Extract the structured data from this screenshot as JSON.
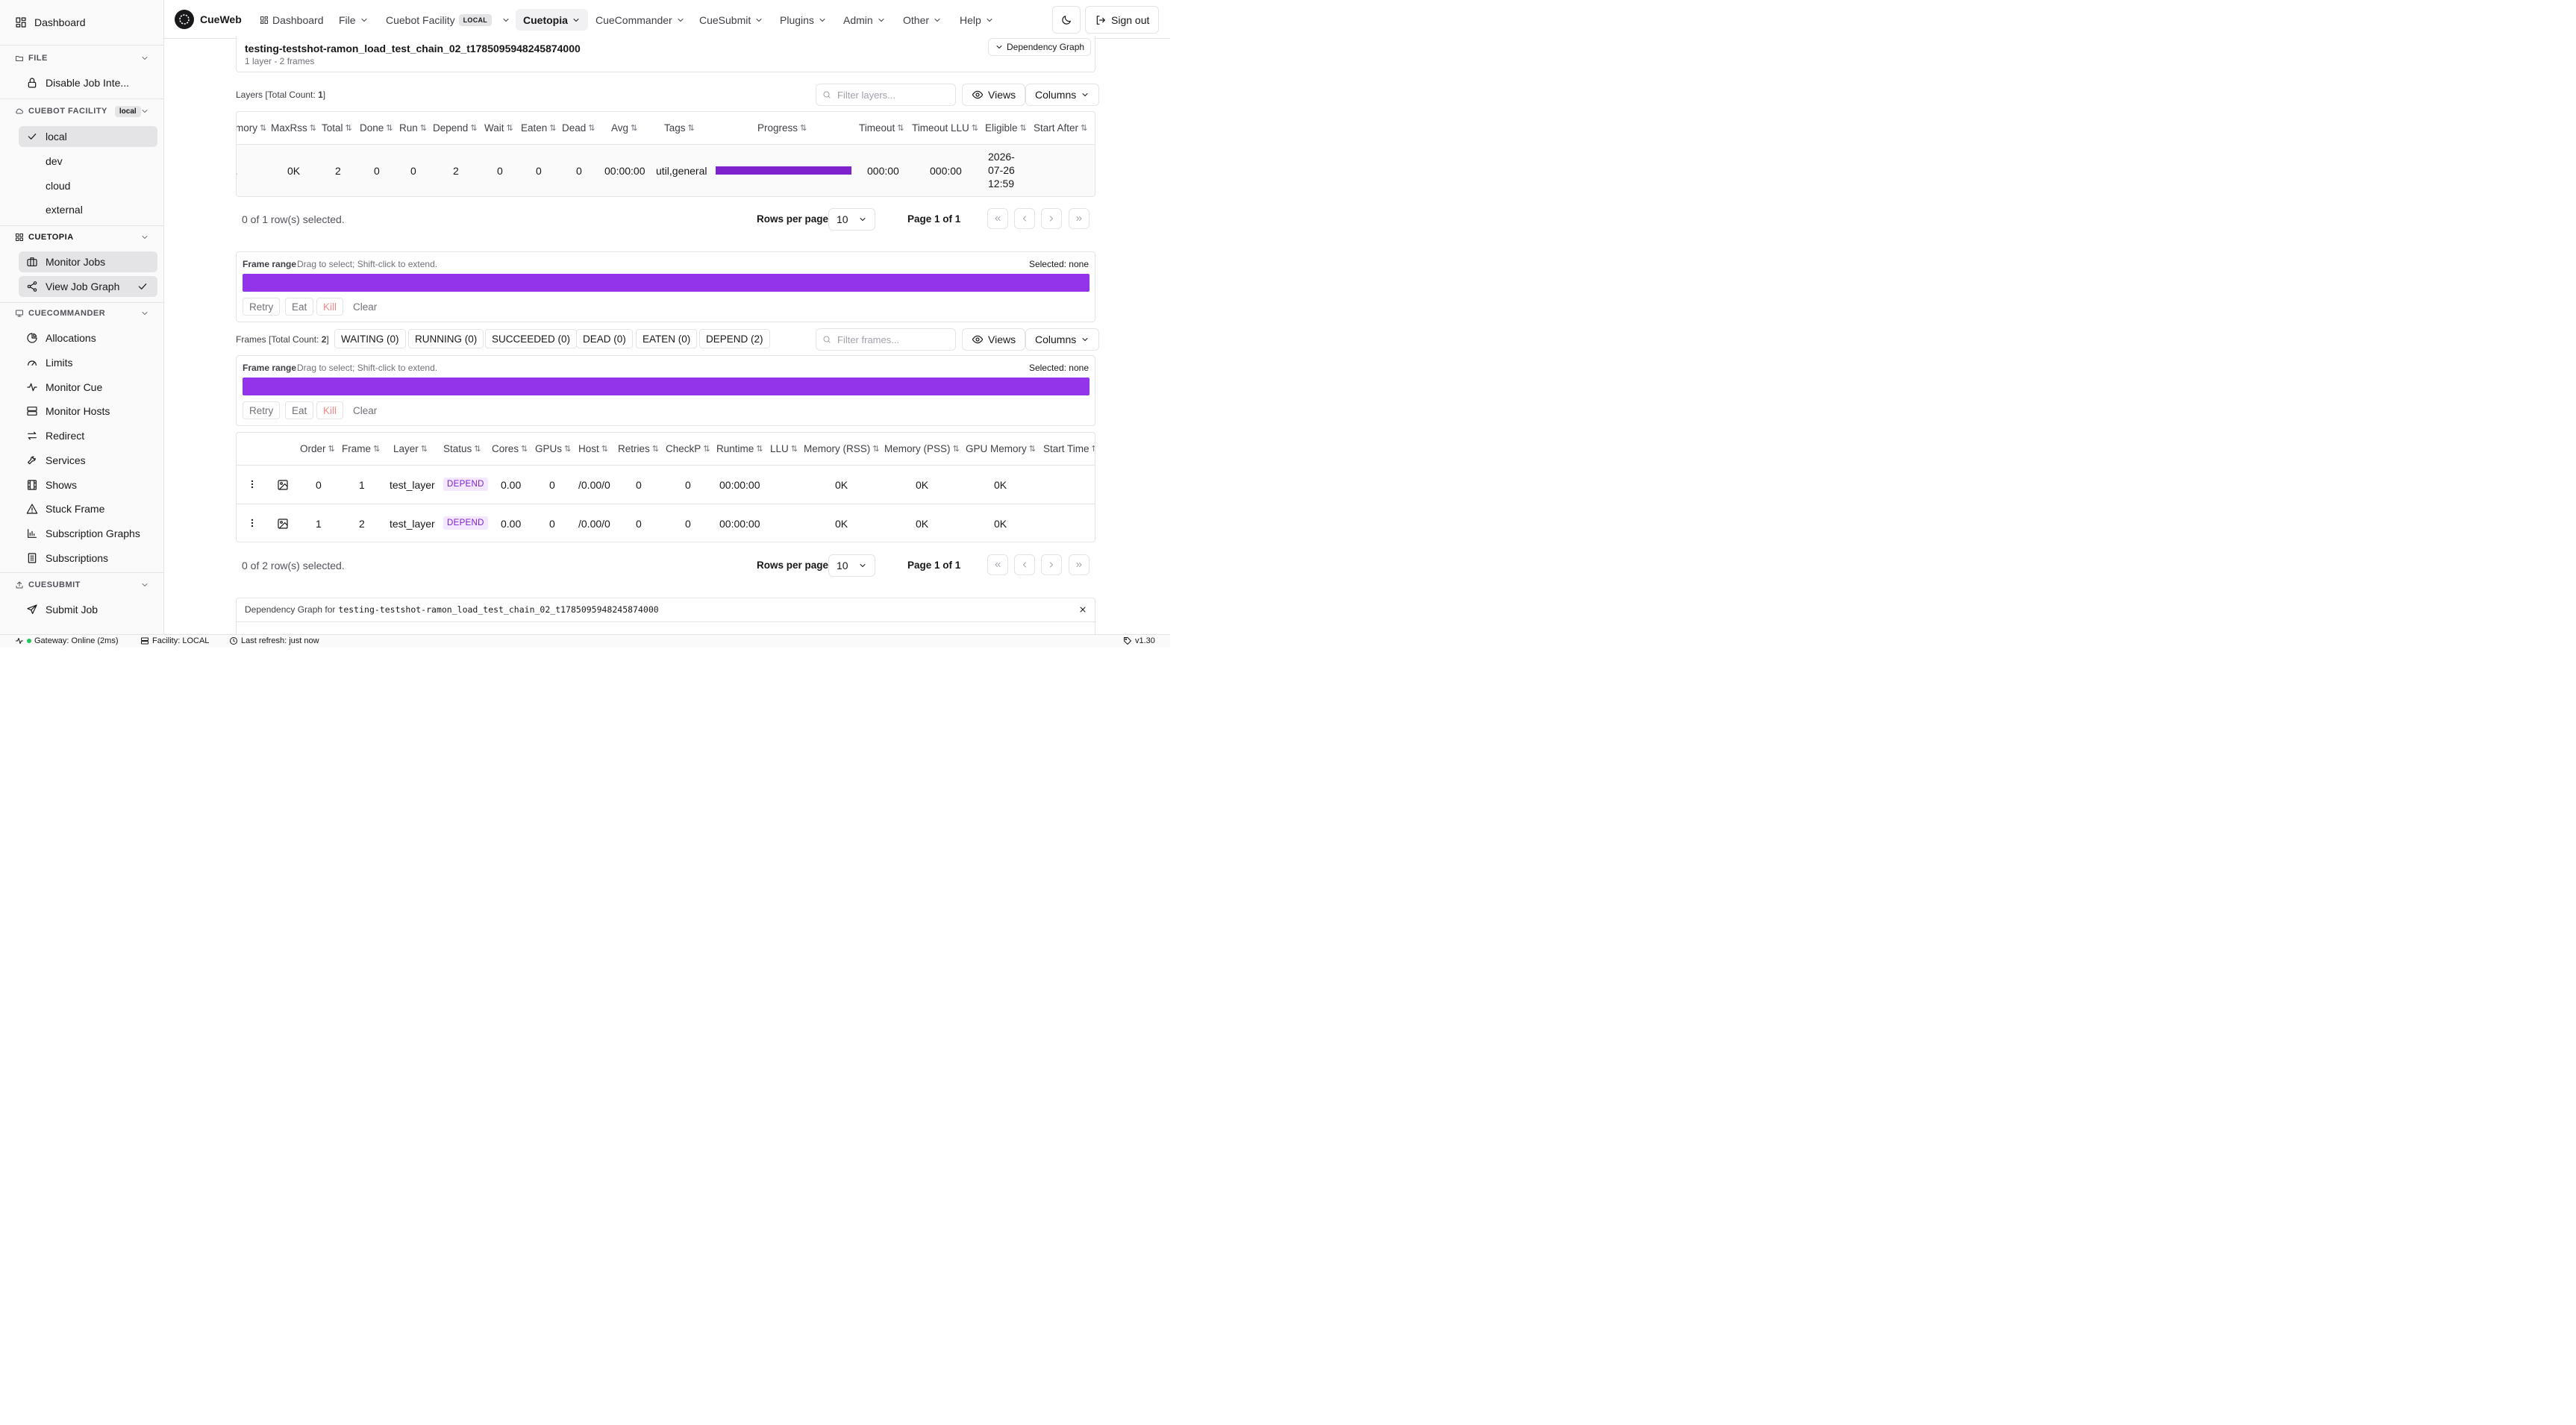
{
  "sidebar": {
    "dashboard": "Dashboard",
    "file_section": "FILE",
    "file_items": [
      "Disable Job Inte..."
    ],
    "facility_section": "CUEBOT FACILITY",
    "facility_badge": "local",
    "facility_items": [
      "local",
      "dev",
      "cloud",
      "external"
    ],
    "cuetopia_section": "CUETOPIA",
    "cuetopia_items": [
      "Monitor Jobs",
      "View Job Graph"
    ],
    "cuecommander_section": "CUECOMMANDER",
    "cuecommander_items": [
      "Allocations",
      "Limits",
      "Monitor Cue",
      "Monitor Hosts",
      "Redirect",
      "Services",
      "Shows",
      "Stuck Frame",
      "Subscription Graphs",
      "Subscriptions"
    ],
    "cuesubmit_section": "CUESUBMIT",
    "cuesubmit_items": [
      "Submit Job"
    ]
  },
  "nav": {
    "brand": "CueWeb",
    "dashboard": "Dashboard",
    "file": "File",
    "facility": "Cuebot Facility",
    "facility_badge": "LOCAL",
    "cuetopia": "Cuetopia",
    "cuecommander": "CueCommander",
    "cuesubmit": "CueSubmit",
    "plugins": "Plugins",
    "admin": "Admin",
    "other": "Other",
    "help": "Help",
    "sign_out": "Sign out"
  },
  "job": {
    "name": "testing-testshot-ramon_load_test_chain_02_t1785095948245874000",
    "summary": "1 layer - 2 frames",
    "dep_graph_btn": "Dependency Graph"
  },
  "layers": {
    "title_prefix": "Layers [Total Count: ",
    "count": "1",
    "title_suffix": "]",
    "filter_placeholder": "Filter layers...",
    "views": "Views",
    "columns": "Columns",
    "headers": [
      "mory",
      "MaxRss",
      "Total",
      "Done",
      "Run",
      "Depend",
      "Wait",
      "Eaten",
      "Dead",
      "Avg",
      "Tags",
      "Progress",
      "Timeout",
      "Timeout LLU",
      "Eligible",
      "Start After"
    ],
    "row": {
      "memory": "",
      "maxrss": "0K",
      "total": "2",
      "done": "0",
      "run": "0",
      "depend": "2",
      "wait": "0",
      "eaten": "0",
      "dead": "0",
      "avg": "00:00:00",
      "tags": "util,general",
      "progress_depend_fraction": 1.0,
      "timeout": "000:00",
      "timeout_llu": "000:00",
      "eligible_1": "2026-",
      "eligible_2": "07-26",
      "eligible_3": "12:59"
    },
    "selected": "0 of 1 row(s) selected.",
    "rows_per_page_label": "Rows per page",
    "rows_per_page": "10",
    "page": "Page 1 of 1"
  },
  "frame_range_1": {
    "label": "Frame range",
    "hint": "Drag to select; Shift-click to extend.",
    "selected": "Selected: none",
    "actions": [
      "Retry",
      "Eat",
      "Kill",
      "Clear"
    ]
  },
  "frames": {
    "title_prefix": "Frames [Total Count: ",
    "count": "2",
    "title_suffix": "]",
    "filters": [
      "WAITING (0)",
      "RUNNING (0)",
      "SUCCEEDED (0)",
      "DEAD (0)",
      "EATEN (0)",
      "DEPEND (2)"
    ],
    "filter_placeholder": "Filter frames...",
    "views": "Views",
    "columns": "Columns",
    "headers": [
      "Order",
      "Frame",
      "Layer",
      "Status",
      "Cores",
      "GPUs",
      "Host",
      "Retries",
      "CheckP",
      "Runtime",
      "LLU",
      "Memory (RSS)",
      "Memory (PSS)",
      "GPU Memory",
      "Start Time"
    ],
    "rows": [
      {
        "order": "0",
        "frame": "1",
        "layer": "test_layer",
        "status": "DEPEND",
        "cores": "0.00",
        "gpus": "0",
        "host": "/0.00/0",
        "retries": "0",
        "checkp": "0",
        "runtime": "00:00:00",
        "llu": "",
        "rss": "0K",
        "pss": "0K",
        "gpu_mem": "0K"
      },
      {
        "order": "1",
        "frame": "2",
        "layer": "test_layer",
        "status": "DEPEND",
        "cores": "0.00",
        "gpus": "0",
        "host": "/0.00/0",
        "retries": "0",
        "checkp": "0",
        "runtime": "00:00:00",
        "llu": "",
        "rss": "0K",
        "pss": "0K",
        "gpu_mem": "0K"
      }
    ],
    "selected": "0 of 2 row(s) selected.",
    "rows_per_page_label": "Rows per page",
    "rows_per_page": "10",
    "page": "Page 1 of 1"
  },
  "frame_range_2": {
    "label": "Frame range",
    "hint": "Drag to select; Shift-click to extend.",
    "selected": "Selected: none",
    "actions": [
      "Retry",
      "Eat",
      "Kill",
      "Clear"
    ]
  },
  "dep_graph_panel": {
    "label": "Dependency Graph for",
    "job": "testing-testshot-ramon_load_test_chain_02_t1785095948245874000"
  },
  "statusbar": {
    "gateway": "Gateway: Online (2ms)",
    "facility": "Facility: LOCAL",
    "refresh": "Last refresh: just now",
    "version": "v1.30"
  },
  "colors": {
    "accent_purple": "#9333ea",
    "progress_purple": "#7e22ce",
    "online_green": "#22c55e",
    "kill_red": "#f08a8a"
  }
}
